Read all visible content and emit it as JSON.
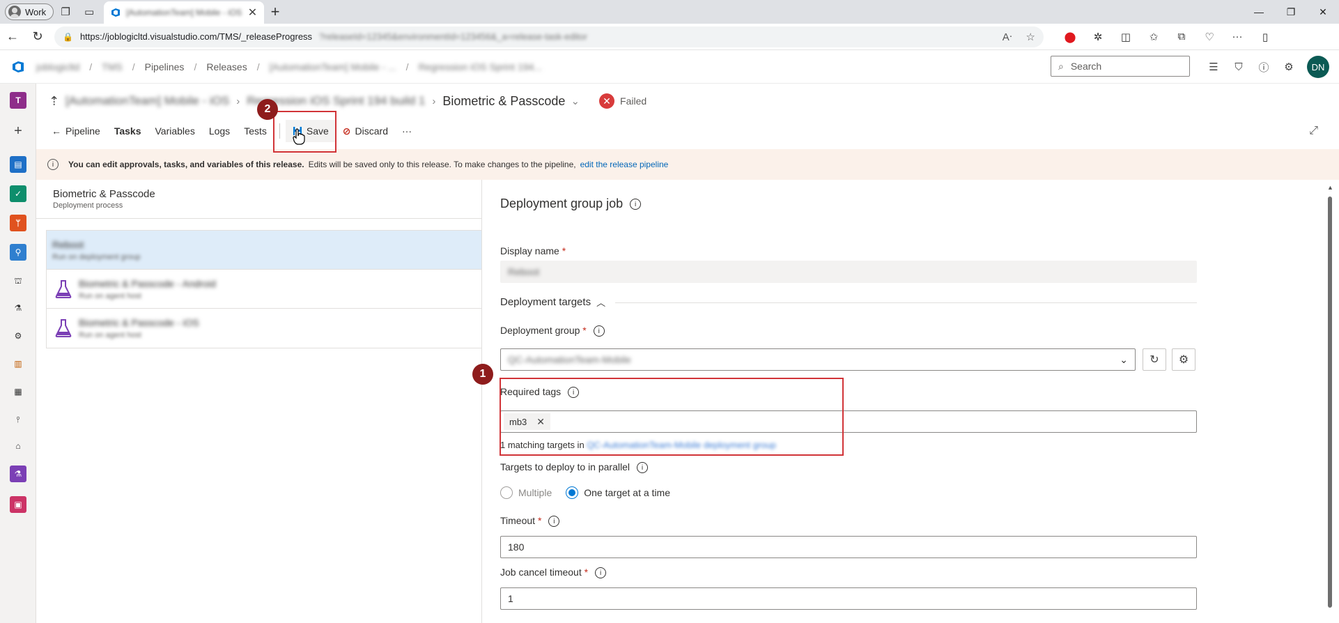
{
  "browser": {
    "profile_label": "Work",
    "tab_title": "[AutomationTeam] Mobile - iOS",
    "url_host": "https://joblogicltd.visualstudio.com/TMS/_releaseProgress",
    "url_rest": "?releaseId=12345&environmentId=123456&_a=release-task-editor"
  },
  "ado": {
    "breadcrumbs": [
      "joblogicltd",
      "TMS",
      "Pipelines",
      "Releases",
      "[AutomationTeam] Mobile - ...",
      "Regression iOS Sprint 194..."
    ],
    "search_placeholder": "Search",
    "user_initials": "DN"
  },
  "page": {
    "pipeline_name": "[AutomationTeam] Mobile - iOS",
    "release_name": "Regression iOS Sprint 194 build 1",
    "stage_name": "Biometric & Passcode",
    "status": "Failed"
  },
  "tabs": [
    {
      "label": "Pipeline"
    },
    {
      "label": "Tasks"
    },
    {
      "label": "Variables"
    },
    {
      "label": "Logs"
    },
    {
      "label": "Tests"
    }
  ],
  "commands": {
    "save": "Save",
    "discard": "Discard",
    "more": "···"
  },
  "banner": {
    "bold_text": "You can edit approvals, tasks, and variables of this release.",
    "text": "Edits will be saved only to this release. To make changes to the pipeline,",
    "link": "edit the release pipeline"
  },
  "left_pane": {
    "title": "Biometric & Passcode",
    "subtitle": "Deployment process",
    "items": [
      {
        "title": "Reboot",
        "subtitle": "Run on deployment group"
      },
      {
        "title": "Biometric & Passcode - Android",
        "subtitle": "Run on agent host"
      },
      {
        "title": "Biometric & Passcode - iOS",
        "subtitle": "Run on agent host"
      }
    ]
  },
  "right_pane": {
    "heading": "Deployment group job",
    "display_name_label": "Display name",
    "display_name_value": "Reboot",
    "targets_section": "Deployment targets",
    "deployment_group_label": "Deployment group",
    "deployment_group_value": "QC-AutomationTeam-Mobile",
    "required_tags_label": "Required tags",
    "tags": [
      "mb3"
    ],
    "matching_prefix": "1 matching targets in",
    "matching_group": "QC-AutomationTeam-Mobile deployment group",
    "parallel_label": "Targets to deploy to in parallel",
    "parallel_options": [
      "Multiple",
      "One target at a time"
    ],
    "parallel_selected": "One target at a time",
    "timeout_label": "Timeout",
    "timeout_value": "180",
    "cancel_timeout_label": "Job cancel timeout",
    "cancel_timeout_value": "1"
  },
  "annotations": {
    "badge_1": "1",
    "badge_2": "2",
    "color": "#d13438",
    "badge_color": "#8e1c1c"
  },
  "colors": {
    "accent": "#0078d4",
    "failed": "#d83b3b",
    "selected_row": "#deecf9",
    "banner_bg": "#fbf1ea"
  }
}
